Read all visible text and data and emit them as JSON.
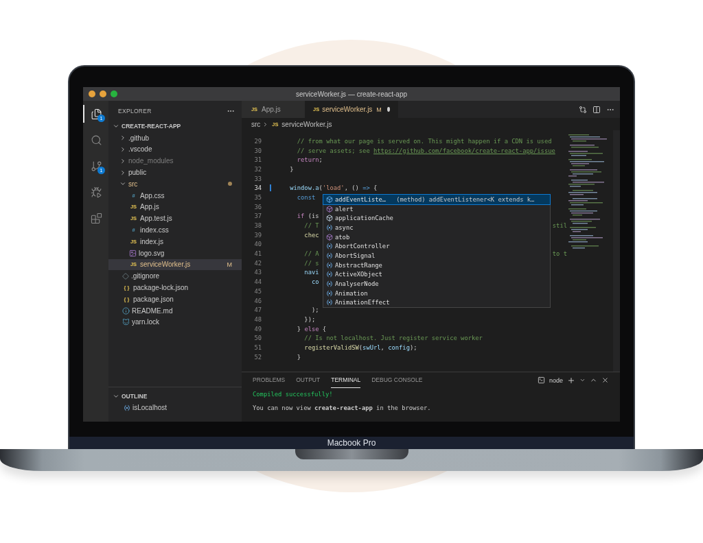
{
  "window": {
    "title": "serviceWorker.js — create-react-app"
  },
  "activity_bar": [
    {
      "kind": "files",
      "selected": true,
      "badge": "1"
    },
    {
      "kind": "search",
      "selected": false
    },
    {
      "kind": "source-control",
      "selected": false,
      "badge": "1"
    },
    {
      "kind": "run",
      "selected": false
    },
    {
      "kind": "extensions",
      "selected": false
    }
  ],
  "explorer": {
    "title": "EXPLORER",
    "tree": [
      {
        "label": "CREATE-REACT-APP",
        "kind": "root",
        "expanded": true,
        "selected": false,
        "modified": false,
        "ignored": false,
        "children": [
          {
            "label": ".github",
            "kind": "folder",
            "expanded": false,
            "selected": false,
            "modified": false,
            "ignored": false
          },
          {
            "label": ".vscode",
            "kind": "folder",
            "expanded": false,
            "selected": false,
            "modified": false,
            "ignored": false
          },
          {
            "label": "node_modules",
            "kind": "folder",
            "expanded": false,
            "selected": false,
            "modified": false,
            "ignored": true
          },
          {
            "label": "public",
            "kind": "folder",
            "expanded": false,
            "selected": false,
            "modified": false,
            "ignored": false
          },
          {
            "label": "src",
            "kind": "folder",
            "expanded": true,
            "selected": false,
            "modified": true,
            "ignored": false,
            "children": [
              {
                "label": "App.css",
                "kind": "css",
                "glyph": "#",
                "selected": false,
                "modified": false,
                "ignored": false
              },
              {
                "label": "App.js",
                "kind": "js",
                "glyph": "JS",
                "selected": false,
                "modified": false,
                "ignored": false
              },
              {
                "label": "App.test.js",
                "kind": "js",
                "glyph": "JS",
                "selected": false,
                "modified": false,
                "ignored": false
              },
              {
                "label": "index.css",
                "kind": "css",
                "glyph": "#",
                "selected": false,
                "modified": false,
                "ignored": false
              },
              {
                "label": "index.js",
                "kind": "js",
                "glyph": "JS",
                "selected": false,
                "modified": false,
                "ignored": false
              },
              {
                "label": "logo.svg",
                "kind": "image",
                "selected": false,
                "modified": false,
                "ignored": false
              },
              {
                "label": "serviceWorker.js",
                "kind": "js",
                "glyph": "JS",
                "selected": true,
                "modified": true,
                "ignored": false,
                "status": "M"
              }
            ]
          },
          {
            "label": ".gitignore",
            "kind": "git",
            "selected": false,
            "modified": false,
            "ignored": false
          },
          {
            "label": "package-lock.json",
            "kind": "json",
            "glyph": "{ }",
            "selected": false,
            "modified": false,
            "ignored": false
          },
          {
            "label": "package.json",
            "kind": "json",
            "glyph": "{ }",
            "selected": false,
            "modified": false,
            "ignored": false
          },
          {
            "label": "README.md",
            "kind": "info",
            "selected": false,
            "modified": false,
            "ignored": false
          },
          {
            "label": "yarn.lock",
            "kind": "yarn",
            "selected": false,
            "modified": false,
            "ignored": false
          }
        ]
      }
    ]
  },
  "outline": {
    "title": "OUTLINE",
    "expanded": true,
    "items": [
      {
        "label": "isLocalhost",
        "kind": "variable"
      }
    ]
  },
  "tabs": [
    {
      "label": "App.js",
      "glyph": "JS",
      "selected": false,
      "unsaved": false
    },
    {
      "label": "serviceWorker.js",
      "glyph": "JS",
      "selected": true,
      "unsaved": true,
      "status": "M"
    }
  ],
  "breadcrumb": {
    "folder": "src",
    "glyph": "JS",
    "file": "serviceWorker.js"
  },
  "code_lines": [
    {
      "number": "29",
      "current": false,
      "tokens": [
        {
          "kind": "comment",
          "text": "      // from what our page is served on. This might happen if a CDN is used"
        }
      ]
    },
    {
      "number": "30",
      "current": false,
      "tokens": [
        {
          "kind": "comment",
          "text": "      // serve assets; see "
        },
        {
          "kind": "link",
          "text": "https://github.com/facebook/create-react-app/issue"
        }
      ]
    },
    {
      "number": "31",
      "current": false,
      "tokens": [
        {
          "kind": "keyword",
          "text": "      return"
        },
        {
          "kind": "plain",
          "text": ";"
        }
      ]
    },
    {
      "number": "32",
      "current": false,
      "tokens": [
        {
          "kind": "plain",
          "text": "    }"
        }
      ]
    },
    {
      "number": "33",
      "current": false
    },
    {
      "number": "34",
      "current": true,
      "tokens": [
        {
          "kind": "var",
          "text": "    window.a"
        },
        {
          "kind": "plain",
          "text": "("
        },
        {
          "kind": "string",
          "text": "'load'"
        },
        {
          "kind": "plain",
          "text": ", () "
        },
        {
          "kind": "storage",
          "text": "=>"
        },
        {
          "kind": "plain",
          "text": " {"
        }
      ]
    },
    {
      "number": "35",
      "current": false,
      "tokens": [
        {
          "kind": "storage",
          "text": "      const"
        }
      ]
    },
    {
      "number": "36",
      "current": false
    },
    {
      "number": "37",
      "current": false,
      "tokens": [
        {
          "kind": "keyword",
          "text": "      if"
        },
        {
          "kind": "plain",
          "text": " (is"
        }
      ]
    },
    {
      "number": "38",
      "current": false,
      "tokens": [
        {
          "kind": "comment",
          "text": "        // T"
        }
      ],
      "tail": "stil"
    },
    {
      "number": "39",
      "current": false,
      "tokens": [
        {
          "kind": "fn",
          "text": "        chec"
        }
      ]
    },
    {
      "number": "40",
      "current": false
    },
    {
      "number": "41",
      "current": false,
      "tokens": [
        {
          "kind": "comment",
          "text": "        // A"
        }
      ],
      "tail": "to t"
    },
    {
      "number": "42",
      "current": false,
      "tokens": [
        {
          "kind": "comment",
          "text": "        // s"
        }
      ]
    },
    {
      "number": "43",
      "current": false,
      "tokens": [
        {
          "kind": "var",
          "text": "        navi"
        }
      ]
    },
    {
      "number": "44",
      "current": false,
      "tokens": [
        {
          "kind": "var",
          "text": "          co"
        }
      ]
    },
    {
      "number": "45",
      "current": false
    },
    {
      "number": "46",
      "current": false
    },
    {
      "number": "47",
      "current": false,
      "tokens": [
        {
          "kind": "plain",
          "text": "          );"
        }
      ]
    },
    {
      "number": "48",
      "current": false,
      "tokens": [
        {
          "kind": "plain",
          "text": "        });"
        }
      ]
    },
    {
      "number": "49",
      "current": false,
      "tokens": [
        {
          "kind": "plain",
          "text": "      } "
        },
        {
          "kind": "keyword",
          "text": "else"
        },
        {
          "kind": "plain",
          "text": " {"
        }
      ]
    },
    {
      "number": "50",
      "current": false,
      "tokens": [
        {
          "kind": "comment",
          "text": "        // Is not localhost. Just register service worker"
        }
      ]
    },
    {
      "number": "51",
      "current": false,
      "tokens": [
        {
          "kind": "fn",
          "text": "        registerValidSW"
        },
        {
          "kind": "plain",
          "text": "("
        },
        {
          "kind": "var",
          "text": "swUrl"
        },
        {
          "kind": "plain",
          "text": ", "
        },
        {
          "kind": "var",
          "text": "config"
        },
        {
          "kind": "plain",
          "text": ");"
        }
      ]
    },
    {
      "number": "52",
      "current": false,
      "tokens": [
        {
          "kind": "plain",
          "text": "      }"
        }
      ]
    }
  ],
  "suggestions": [
    {
      "label": "addEventListe…",
      "kind": "method",
      "selected": true,
      "detail": "(method) addEventListener<K extends k…"
    },
    {
      "label": "alert",
      "kind": "function",
      "selected": false
    },
    {
      "label": "applicationCache",
      "kind": "property",
      "selected": false
    },
    {
      "label": "async",
      "kind": "variable",
      "selected": false
    },
    {
      "label": "atob",
      "kind": "function",
      "selected": false
    },
    {
      "label": "AbortController",
      "kind": "variable",
      "selected": false
    },
    {
      "label": "AbortSignal",
      "kind": "variable",
      "selected": false
    },
    {
      "label": "AbstractRange",
      "kind": "variable",
      "selected": false
    },
    {
      "label": "ActiveXObject",
      "kind": "variable",
      "selected": false
    },
    {
      "label": "AnalyserNode",
      "kind": "variable",
      "selected": false
    },
    {
      "label": "Animation",
      "kind": "variable",
      "selected": false
    },
    {
      "label": "AnimationEffect",
      "kind": "variable",
      "selected": false
    }
  ],
  "panel": {
    "tabs": [
      {
        "label": "PROBLEMS",
        "selected": false
      },
      {
        "label": "OUTPUT",
        "selected": false
      },
      {
        "label": "TERMINAL",
        "selected": true
      },
      {
        "label": "DEBUG CONSOLE",
        "selected": false
      }
    ],
    "profile": "node",
    "lines": [
      {
        "kind": "success",
        "text": "Compiled successfully!"
      },
      {
        "kind": "plain",
        "text": "You can now view **create-react-app** in the browser."
      }
    ]
  },
  "device": {
    "label": "Macbook Pro"
  }
}
